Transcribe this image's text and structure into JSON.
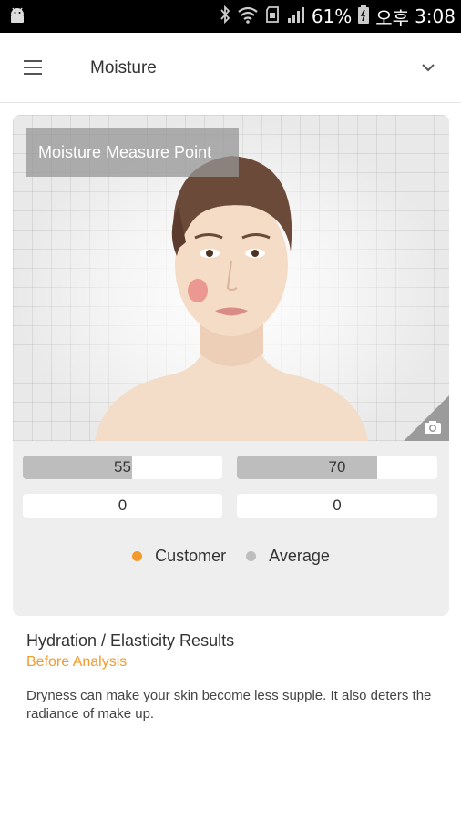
{
  "status_bar": {
    "battery_percent": "61%",
    "ampm": "오후",
    "time": "3:08",
    "icons": [
      "android-icon",
      "bluetooth-icon",
      "wifi-icon",
      "sd-card-icon",
      "signal-icon",
      "battery-icon"
    ]
  },
  "header": {
    "title": "Moisture",
    "menu_icon": "hamburger-menu-icon",
    "dropdown_icon": "chevron-down-icon"
  },
  "measure": {
    "label": "Moisture Measure Point",
    "camera_icon": "camera-icon"
  },
  "bars": {
    "customer_top": {
      "value": "55",
      "fill_fraction": 0.55
    },
    "average_top": {
      "value": "70",
      "fill_fraction": 0.7
    },
    "customer_bottom": {
      "value": "0",
      "fill_fraction": 0
    },
    "average_bottom": {
      "value": "0",
      "fill_fraction": 0
    }
  },
  "legend": {
    "customer_label": "Customer",
    "average_label": "Average",
    "customer_color": "#f39a2c",
    "average_color": "#bdbdbd"
  },
  "results": {
    "title": "Hydration / Elasticity Results",
    "subtitle": "Before Analysis",
    "description": "Dryness can make your skin become less supple. It also deters the radiance of make up."
  },
  "colors": {
    "accent": "#f39a2c",
    "card_bg": "#eeeeee"
  }
}
